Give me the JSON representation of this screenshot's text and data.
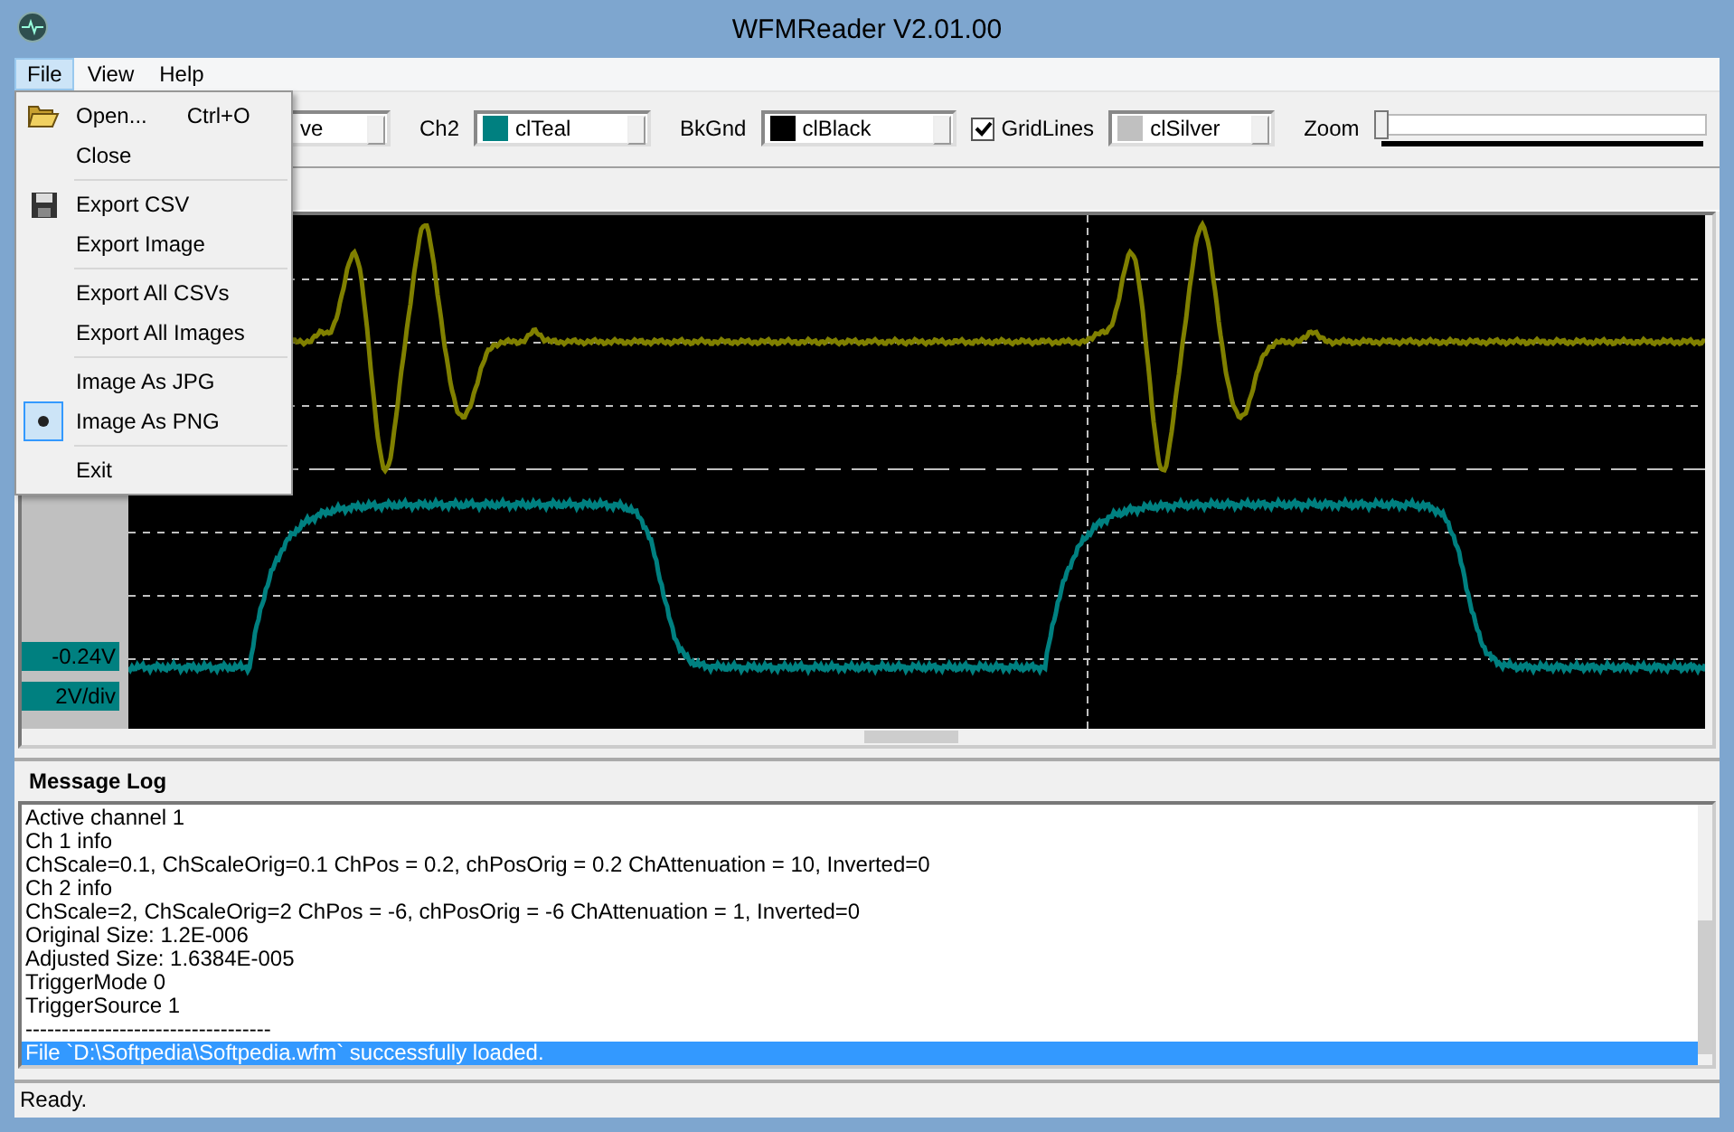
{
  "window": {
    "title": "WFMReader V2.01.00"
  },
  "menu": [
    {
      "label": "File",
      "selected": true
    },
    {
      "label": "View",
      "selected": false
    },
    {
      "label": "Help",
      "selected": false
    }
  ],
  "file_menu": [
    {
      "kind": "item",
      "label": "Open...",
      "shortcut": "Ctrl+O"
    },
    {
      "kind": "item",
      "label": "Close"
    },
    {
      "kind": "separator"
    },
    {
      "kind": "item",
      "label": "Export CSV"
    },
    {
      "kind": "item",
      "label": "Export Image"
    },
    {
      "kind": "separator"
    },
    {
      "kind": "item",
      "label": "Export All CSVs"
    },
    {
      "kind": "item",
      "label": "Export All Images"
    },
    {
      "kind": "separator"
    },
    {
      "kind": "radio",
      "label": "Image As JPG",
      "checked": false
    },
    {
      "kind": "radio",
      "label": "Image As PNG",
      "checked": true
    },
    {
      "kind": "separator"
    },
    {
      "kind": "item",
      "label": "Exit"
    }
  ],
  "toolbar": {
    "ch1_value": "ve",
    "ch2": {
      "label": "Ch2",
      "value": "clTeal",
      "color": "#008080"
    },
    "bkgnd": {
      "label": "BkGnd",
      "value": "clBlack",
      "color": "#000000"
    },
    "gridlines": {
      "label": "GridLines",
      "checked": true,
      "value": "clSilver",
      "color": "#c0c0c0"
    },
    "zoom": {
      "label": "Zoom",
      "level": 0
    }
  },
  "scope": {
    "offset_label": "-0.24V",
    "scale_label": "2V/div"
  },
  "message_log": {
    "title": "Message Log",
    "lines": [
      {
        "text": "Active channel 1",
        "selected": false
      },
      {
        "text": "Ch 1 info",
        "selected": false
      },
      {
        "text": "ChScale=0.1, ChScaleOrig=0.1 ChPos = 0.2, chPosOrig = 0.2 ChAttenuation = 10, Inverted=0",
        "selected": false
      },
      {
        "text": "Ch 2 info",
        "selected": false
      },
      {
        "text": "ChScale=2, ChScaleOrig=2 ChPos = -6, chPosOrig = -6 ChAttenuation = 1, Inverted=0",
        "selected": false
      },
      {
        "text": "Original Size: 1.2E-006",
        "selected": false
      },
      {
        "text": "Adjusted Size: 1.6384E-005",
        "selected": false
      },
      {
        "text": "TriggerMode 0",
        "selected": false
      },
      {
        "text": "TriggerSource 1",
        "selected": false
      },
      {
        "text": "----------------------------------",
        "selected": false
      },
      {
        "text": "File `D:\\Softpedia\\Softpedia.wfm` successfully loaded.",
        "selected": true
      }
    ]
  },
  "status_bar": "Ready."
}
